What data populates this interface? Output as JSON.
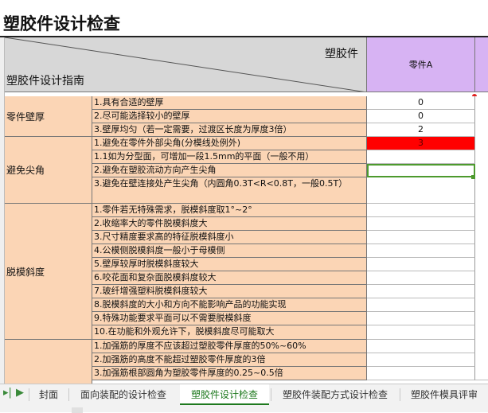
{
  "title": "塑胶件设计检查",
  "header": {
    "top_right": "塑胶件",
    "bottom_left": "塑胶件设计指南",
    "part_name": "零件A"
  },
  "colors": {
    "header_gray": "#d7d7d7",
    "part_purple": "#d7b3f3",
    "category_peach": "#fbd5b5",
    "alert_red": "#ff0000",
    "selection_green": "#4d9a2e",
    "active_tab": "#1f7a1f"
  },
  "categories": [
    "零件壁厚",
    "避免尖角",
    "脱模斜度",
    ""
  ],
  "items": [
    "1.具有合适的壁厚",
    "2.尽可能选择较小的壁厚",
    "3.壁厚均匀（若一定需要，过渡区长度为厚度3倍）",
    "1.避免在零件外部尖角(分模线处例外)",
    "1.1如为分型面，可增加一段1.5mm的平面（一般不用）",
    "2.避免在塑胶流动方向产生尖角",
    "3.避免在壁连接处产生尖角（内圆角0.3T<R<0.8T，一般0.5T）",
    "1.零件若无特殊需求，脱模斜度取1°~2°",
    "2.收缩率大的零件脱模斜度大",
    "3.尺寸精度要求高的特征脱模斜度小",
    "4.公模侧脱模斜度一般小于母模侧",
    "5.壁厚较厚时脱模斜度较大",
    "6.咬花面和复杂面脱模斜度较大",
    "7.玻纤增强塑料脱模斜度较大",
    "8.脱模斜度的大小和方向不能影响产品的功能实现",
    "9.特殊功能要求平面可以不需要脱模斜度",
    "10.在功能和外观允许下，脱模斜度尽可能取大",
    "1.加强筋的厚度不应该超过塑胶零件厚度的50%~60%",
    "2.加强筋的高度不能超过塑胶零件厚度的3倍",
    "3.加强筋根部圆角为塑胶零件厚度的0.25~0.5倍"
  ],
  "values": [
    "0",
    "0",
    "2",
    "3",
    "",
    "",
    "",
    "",
    "",
    "",
    "",
    "",
    "",
    "",
    "",
    "",
    "",
    "",
    "",
    ""
  ],
  "tabs": [
    "封面",
    "面向装配的设计检查",
    "塑胶件设计检查",
    "塑胶件装配方式设计检查",
    "塑胶件模具评审"
  ],
  "active_tab_index": 2,
  "nav_icons": [
    "scroll-last-tab-icon",
    "scroll-right-tab-icon"
  ]
}
